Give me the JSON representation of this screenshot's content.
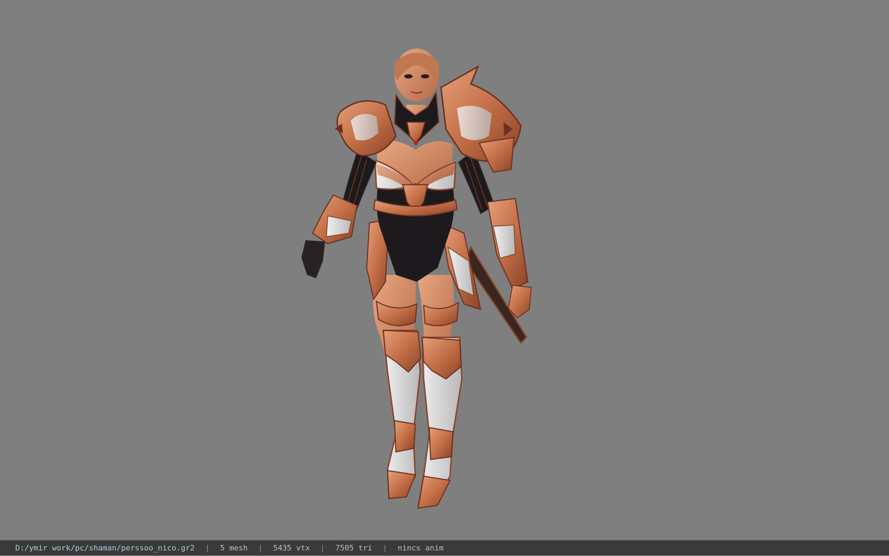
{
  "status_bar": {
    "file_path": "D:/ymir work/pc/shaman/perssoo_nico.gr2",
    "separator": "|",
    "mesh_count": "5 mesh",
    "vertex_count": "5435 vtx",
    "triangle_count": "7505 tri",
    "anim_state": "nincs anim"
  },
  "colors": {
    "viewport_bg": "#7f7f7f",
    "statusbar_bg": "#3a3a3a",
    "path_text": "#9fd3d8",
    "armor_copper": "#c8744e",
    "armor_dark": "#1c1a1c",
    "armor_silver": "#d9d9d9",
    "skin": "#d99270"
  },
  "viewport": {
    "subject": "3d-character-model"
  }
}
